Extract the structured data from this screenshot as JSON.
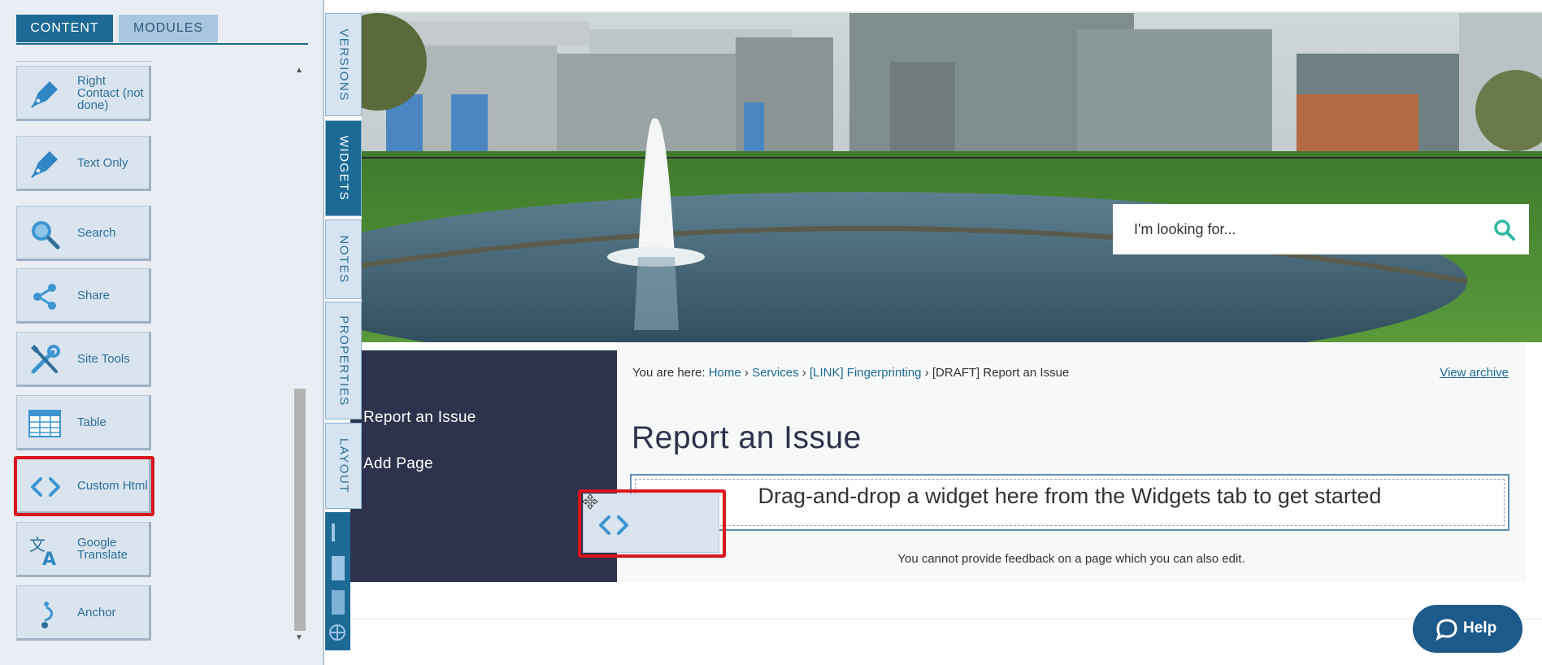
{
  "left_panel": {
    "tabs": {
      "content": "CONTENT",
      "modules": "MODULES"
    },
    "widgets": [
      {
        "label": "Right Contact (not done)",
        "icon": "pen-icon"
      },
      {
        "label": "Text Only",
        "icon": "pen-icon"
      },
      {
        "label": "Search",
        "icon": "search-icon"
      },
      {
        "label": "Share",
        "icon": "share-icon"
      },
      {
        "label": "Site Tools",
        "icon": "tools-icon"
      },
      {
        "label": "Table",
        "icon": "table-icon"
      },
      {
        "label": "Custom Html",
        "icon": "code-icon"
      },
      {
        "label": "Google Translate",
        "icon": "translate-icon"
      },
      {
        "label": "Anchor",
        "icon": "anchor-icon"
      }
    ]
  },
  "vertical_tabs": {
    "versions": "VERSIONS",
    "widgets": "WIDGETS",
    "notes": "NOTES",
    "properties": "PROPERTIES",
    "layout": "LAYOUT"
  },
  "hero": {
    "search_placeholder": "I'm looking for..."
  },
  "side_nav": {
    "items": [
      "Report an Issue",
      "Add Page"
    ]
  },
  "content": {
    "breadcrumb_prefix": "You are here:",
    "breadcrumb": {
      "home": "Home",
      "services": "Services",
      "fingerprinting": "[LINK] Fingerprinting",
      "current": "[DRAFT] Report an Issue"
    },
    "breadcrumb_sep": "›",
    "view_archive": "View archive",
    "title": "Report an Issue",
    "dropzone_text": "Drag-and-drop a widget here from the Widgets tab to get started",
    "feedback": "You cannot provide feedback on a page which you can also edit."
  },
  "help": {
    "label": "Help"
  },
  "colors": {
    "accent": "#1d6a96",
    "highlight": "#d9141c",
    "nav_bg": "#2d334c"
  }
}
